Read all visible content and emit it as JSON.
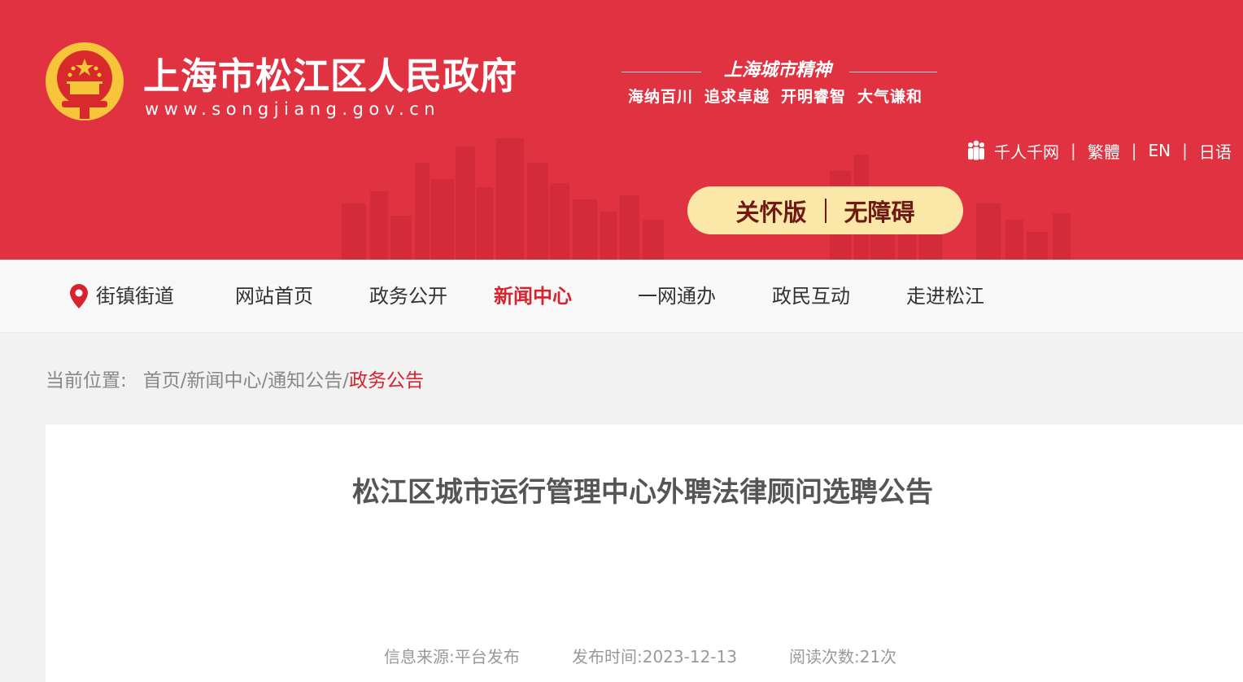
{
  "header": {
    "site_title": "上海市松江区人民政府",
    "site_url": "www.songjiang.gov.cn",
    "spirit_title": "上海城市精神",
    "motto": [
      "海纳百川",
      "追求卓越",
      "开明睿智",
      "大气谦和"
    ],
    "lang_links": [
      "千人千网",
      "繁體",
      "EN",
      "日语"
    ],
    "lang_separator": "|",
    "care_label": "关怀版",
    "accessibility_label": "无障碍",
    "brand_color": "#e03241",
    "pill_color": "#fbe7a8"
  },
  "nav": {
    "items": [
      "街镇街道",
      "网站首页",
      "政务公开",
      "新闻中心",
      "一网通办",
      "政民互动",
      "走进松江"
    ],
    "active": "新闻中心",
    "active_color": "#d8222d"
  },
  "breadcrumb": {
    "label": "当前位置:",
    "items": [
      "首页",
      "新闻中心",
      "通知公告",
      "政务公告"
    ],
    "separator": "/"
  },
  "article": {
    "title": "松江区城市运行管理中心外聘法律顾问选聘公告",
    "source": "信息来源:平台发布",
    "publish_time": "发布时间:2023-12-13",
    "read_count": "阅读次数:21次"
  }
}
